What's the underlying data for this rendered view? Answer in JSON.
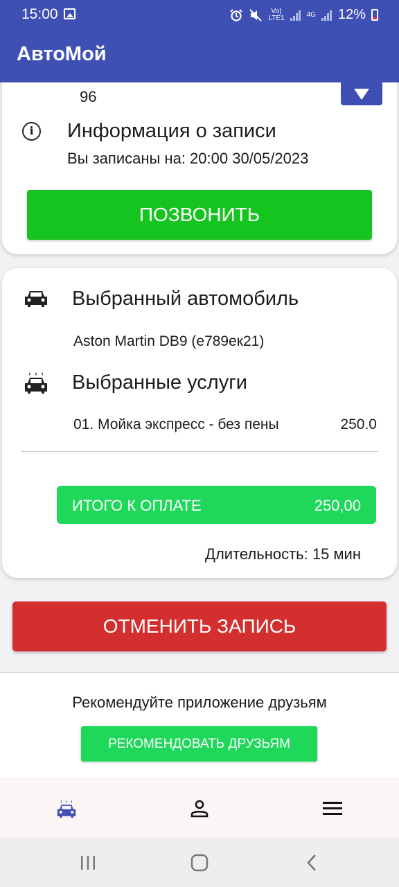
{
  "status_bar": {
    "time": "15:00",
    "network_top": "Vo)",
    "network_bottom": "LTE1",
    "net_4g": "4G",
    "battery": "12%"
  },
  "app": {
    "title": "АвтоМой"
  },
  "booking": {
    "address_tail": "96",
    "info_title": "Информация о записи",
    "info_subtitle": "Вы записаны на: 20:00 30/05/2023",
    "call_label": "ПОЗВОНИТЬ"
  },
  "order": {
    "car_title": "Выбранный автомобиль",
    "car_name": "Aston Martin DB9 (е789ек21)",
    "services_title": "Выбранные услуги",
    "services": [
      {
        "name": "01. Мойка экспресс -  без пены",
        "price": "250.0"
      }
    ],
    "total_label": "ИТОГО К ОПЛАТЕ",
    "total_value": "250,00",
    "duration": "Длительность: 15 мин"
  },
  "cancel_label": "ОТМЕНИТЬ ЗАПИСЬ",
  "recommend": {
    "text": "Рекомендуйте приложение друзьям",
    "button": "РЕКОМЕНДОВАТЬ ДРУЗЬЯМ"
  },
  "bottom_nav": {
    "items": [
      {
        "icon": "car-wash-icon",
        "active": true
      },
      {
        "icon": "profile-icon",
        "active": false
      },
      {
        "icon": "menu-icon",
        "active": false
      }
    ]
  },
  "colors": {
    "primary": "#3e50b4",
    "call_green": "#15c41e",
    "total_green": "#1fd85a",
    "cancel_red": "#d32f2f"
  }
}
